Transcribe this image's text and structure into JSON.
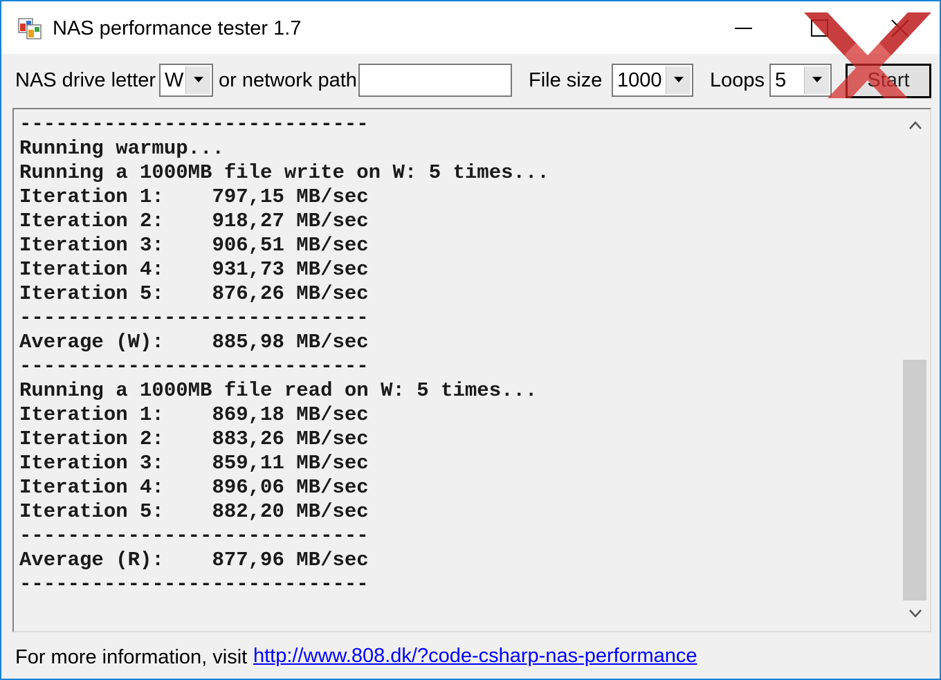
{
  "window": {
    "title": "NAS performance tester 1.7",
    "border_color": "#1883d7",
    "icon": "app-window-icon"
  },
  "title_buttons": {
    "minimize_icon": "minimize-icon",
    "maximize_icon": "maximize-icon",
    "close_icon": "close-icon"
  },
  "brand_mark": "hardwareluxx-xx-logo",
  "toolbar": {
    "drive_label": "NAS drive letter",
    "drive_value": "W",
    "path_label": "or network path",
    "path_value": "",
    "filesize_label": "File size",
    "filesize_value": "1000",
    "loops_label": "Loops",
    "loops_value": "5",
    "start_label": "Start"
  },
  "output": {
    "lines": [
      "-----------------------------",
      "Running warmup...",
      "Running a 1000MB file write on W: 5 times...",
      "Iteration 1:    797,15 MB/sec",
      "Iteration 2:    918,27 MB/sec",
      "Iteration 3:    906,51 MB/sec",
      "Iteration 4:    931,73 MB/sec",
      "Iteration 5:    876,26 MB/sec",
      "-----------------------------",
      "Average (W):    885,98 MB/sec",
      "-----------------------------",
      "Running a 1000MB file read on W: 5 times...",
      "Iteration 1:    869,18 MB/sec",
      "Iteration 2:    883,26 MB/sec",
      "Iteration 3:    859,11 MB/sec",
      "Iteration 4:    896,06 MB/sec",
      "Iteration 5:    882,20 MB/sec",
      "-----------------------------",
      "Average (R):    877,96 MB/sec",
      "-----------------------------"
    ]
  },
  "footer": {
    "info_text": "For more information, visit",
    "link_text": "http://www.808.dk/?code-csharp-nas-performance",
    "link_color": "#0000ff"
  }
}
